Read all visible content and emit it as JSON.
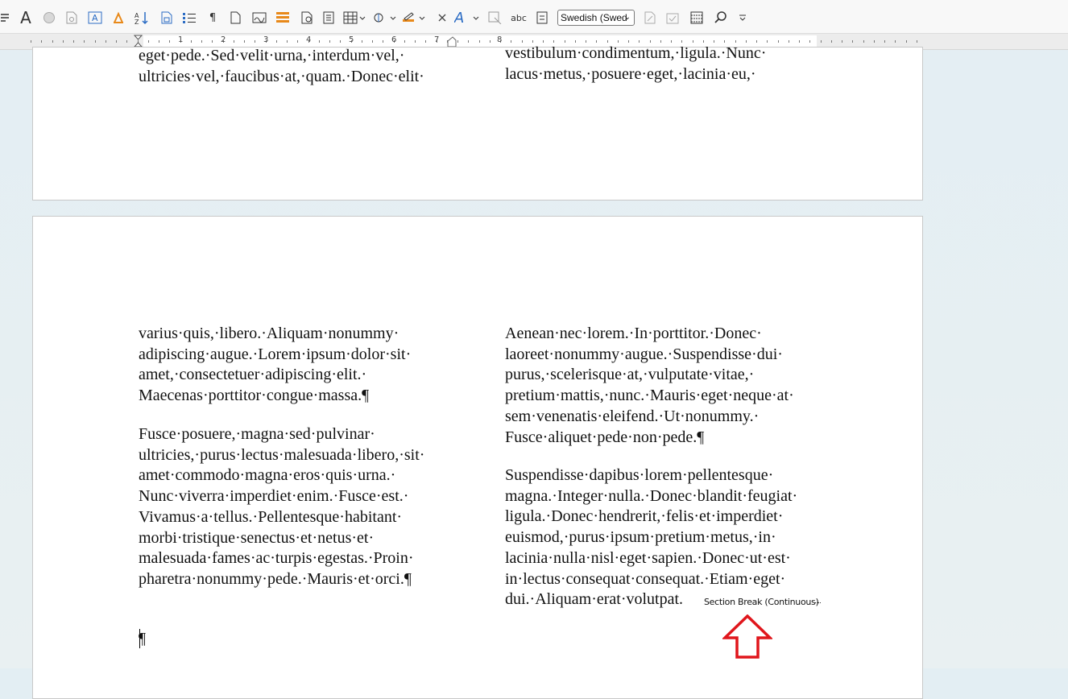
{
  "toolbar": {
    "icons": [
      "styles-icon",
      "font-icon",
      "color-circle-icon",
      "document-icon",
      "text-box-icon",
      "highlight-icon",
      "sort-icon",
      "page-icon",
      "bullet-list-icon",
      "formatting-marks-icon",
      "blank-page-icon",
      "signature-icon",
      "layers-icon",
      "print-preview-icon",
      "form-icon",
      "table-icon",
      "hyperlink-icon",
      "paint-format-icon",
      "close-icon",
      "text-style-icon",
      "compare-icon",
      "spellcheck-icon",
      "word-count-icon",
      "track-changes-icon",
      "accept-icon",
      "grid-icon",
      "find-icon",
      "overflow-icon"
    ],
    "language_select": "Swedish (Swed",
    "chevron": "⌄"
  },
  "ruler": {
    "numbers": [
      "1",
      "2",
      "3",
      "4",
      "5",
      "6",
      "7",
      "8"
    ]
  },
  "page1": {
    "col1": "eget·pede.·Sed·velit·urna,·interdum·vel,·\nultricies·vel,·faucibus·at,·quam.·Donec·elit·",
    "col2": "vestibulum·condimentum,·ligula.·Nunc·\nlacus·metus,·posuere·eget,·lacinia·eu,·"
  },
  "page2": {
    "col1_p1": "varius·quis,·libero.·Aliquam·nonummy·\nadipiscing·augue.·Lorem·ipsum·dolor·sit·\namet,·consectetuer·adipiscing·elit.·\nMaecenas·porttitor·congue·massa.¶",
    "col1_p2": "Fusce·posuere,·magna·sed·pulvinar·\nultricies,·purus·lectus·malesuada·libero,·sit·\namet·commodo·magna·eros·quis·urna.·\nNunc·viverra·imperdiet·enim.·Fusce·est.·\nVivamus·a·tellus.·Pellentesque·habitant·\nmorbi·tristique·senectus·et·netus·et·\nmalesuada·fames·ac·turpis·egestas.·Proin·\npharetra·nonummy·pede.·Mauris·et·orci.¶",
    "col1_p3": "¶",
    "col2_p1": "Aenean·nec·lorem.·In·porttitor.·Donec·\nlaoreet·nonummy·augue.·Suspendisse·dui·\npurus,·scelerisque·at,·vulputate·vitae,·\npretium·mattis,·nunc.·Mauris·eget·neque·at·\nsem·venenatis·eleifend.·Ut·nonummy.·\nFusce·aliquet·pede·non·pede.¶",
    "col2_p2": "Suspendisse·dapibus·lorem·pellentesque·\nmagna.·Integer·nulla.·Donec·blandit·feugiat·\nligula.·Donec·hendrerit,·felis·et·imperdiet·\neuismod,·purus·ipsum·pretium·metus,·in·\nlacinia·nulla·nisl·eget·sapien.·Donec·ut·est·\nin·lectus·consequat·consequat.·Etiam·eget·\ndui.·Aliquam·erat·volutpat.",
    "section_break": "Section Break (Continuous)"
  },
  "colors": {
    "annotation_arrow": "#e0161c",
    "accent_blue": "#2b6cc4",
    "accent_orange": "#e8891a"
  }
}
